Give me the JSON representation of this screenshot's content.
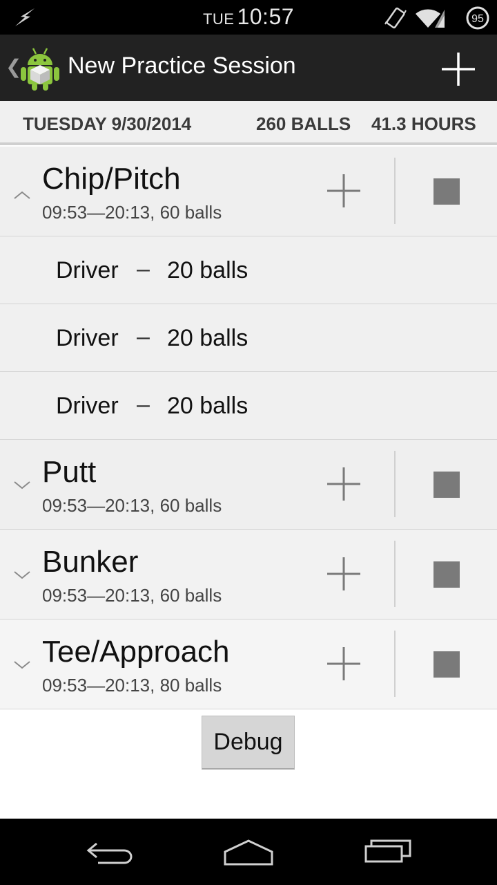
{
  "status_bar": {
    "day": "TUE",
    "time": "10:57",
    "battery": "95"
  },
  "action_bar": {
    "title": "New Practice Session",
    "up_glyph": "❮"
  },
  "summary": {
    "date": "TUESDAY 9/30/2014",
    "balls": "260 BALLS",
    "hours": "41.3 HOURS"
  },
  "groups": [
    {
      "name": "Chip/Pitch",
      "detail": "09:53—20:13, 60 balls",
      "expanded": true
    },
    {
      "name": "Putt",
      "detail": "09:53—20:13, 60 balls",
      "expanded": false
    },
    {
      "name": "Bunker",
      "detail": "09:53—20:13, 60 balls",
      "expanded": false
    },
    {
      "name": "Tee/Approach",
      "detail": "09:53—20:13, 80 balls",
      "expanded": false
    }
  ],
  "items": [
    {
      "club": "Driver",
      "dash": "–",
      "count": "20 balls"
    },
    {
      "club": "Driver",
      "dash": "–",
      "count": "20 balls"
    },
    {
      "club": "Driver",
      "dash": "–",
      "count": "20 balls"
    }
  ],
  "debug_label": "Debug",
  "icons": {
    "status_left": "lightning-icon",
    "vibrate": "vibrate-icon",
    "wifi": "wifi-icon",
    "signal": "signal-icon",
    "battery": "battery-icon",
    "app": "android-logo-icon",
    "add": "plus-icon",
    "add_to_group": "plus-icon",
    "stop": "stop-icon",
    "nav_back": "back-icon",
    "nav_home": "home-icon",
    "nav_recent": "recent-apps-icon"
  },
  "colors": {
    "action_bar": "#222222",
    "list_background": "#efefef",
    "stop_square": "#7a7a7a"
  }
}
